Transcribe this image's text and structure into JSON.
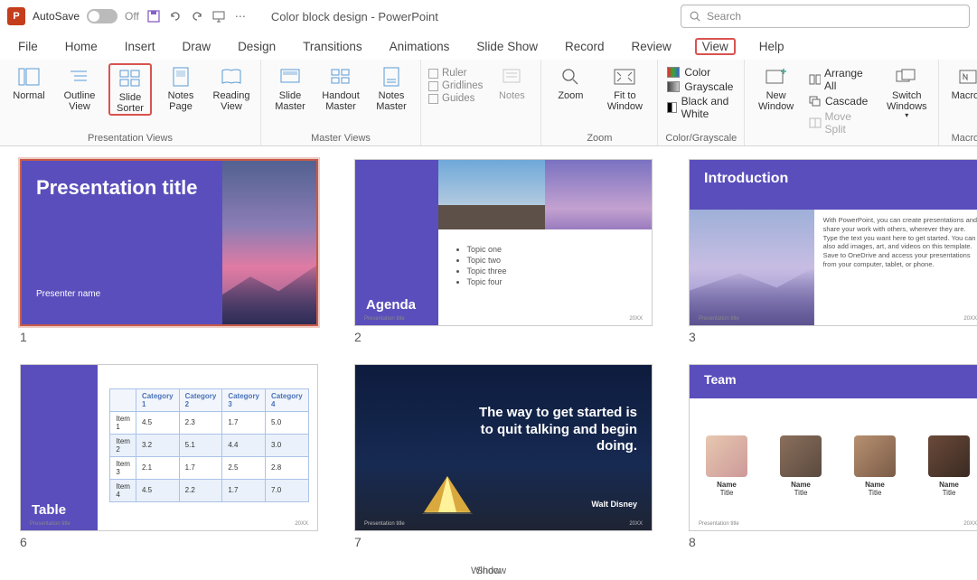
{
  "titlebar": {
    "autosave_label": "AutoSave",
    "autosave_state": "Off",
    "filename": "Color block design  -  PowerPoint",
    "search_placeholder": "Search"
  },
  "tabs": [
    "File",
    "Home",
    "Insert",
    "Draw",
    "Design",
    "Transitions",
    "Animations",
    "Slide Show",
    "Record",
    "Review",
    "View",
    "Help"
  ],
  "selected_tab": "View",
  "ribbon": {
    "presentation_views": {
      "label": "Presentation Views",
      "normal": "Normal",
      "outline": "Outline View",
      "sorter": "Slide Sorter",
      "notes": "Notes Page",
      "reading": "Reading View"
    },
    "master_views": {
      "label": "Master Views",
      "slide": "Slide Master",
      "handout": "Handout Master",
      "notes": "Notes Master"
    },
    "show": {
      "label": "Show",
      "ruler": "Ruler",
      "gridlines": "Gridlines",
      "guides": "Guides",
      "notes": "Notes"
    },
    "zoom": {
      "label": "Zoom",
      "zoom": "Zoom",
      "fit": "Fit to Window"
    },
    "colorgs": {
      "label": "Color/Grayscale",
      "color": "Color",
      "grayscale": "Grayscale",
      "bw": "Black and White"
    },
    "window": {
      "label": "Window",
      "new": "New Window",
      "arrange": "Arrange All",
      "cascade": "Cascade",
      "movesplit": "Move Split",
      "switch": "Switch Windows"
    },
    "macros": {
      "label": "Macros",
      "macros": "Macros"
    }
  },
  "slides": {
    "s1": {
      "num": "1",
      "title": "Presentation title",
      "sub": "Presenter name"
    },
    "s2": {
      "num": "2",
      "title": "Agenda",
      "topics": [
        "Topic one",
        "Topic two",
        "Topic three",
        "Topic four"
      ]
    },
    "s3": {
      "num": "3",
      "title": "Introduction",
      "body": "With PowerPoint, you can create presentations and share your work with others, wherever they are. Type the text you want here to get started. You can also add images, art, and videos on this template. Save to OneDrive and access your presentations from your computer, tablet, or phone."
    },
    "s4": {
      "num": "6",
      "title": "Table",
      "headers": [
        "",
        "Category 1",
        "Category 2",
        "Category 3",
        "Category 4"
      ],
      "rows": [
        [
          "Item 1",
          "4.5",
          "2.3",
          "1.7",
          "5.0"
        ],
        [
          "Item 2",
          "3.2",
          "5.1",
          "4.4",
          "3.0"
        ],
        [
          "Item 3",
          "2.1",
          "1.7",
          "2.5",
          "2.8"
        ],
        [
          "Item 4",
          "4.5",
          "2.2",
          "1.7",
          "7.0"
        ]
      ]
    },
    "s5": {
      "num": "7",
      "quote": "The way to get started is to quit  talking and begin doing.",
      "attr": "Walt Disney"
    },
    "s6": {
      "num": "8",
      "title": "Team",
      "name": "Name",
      "role": "Title"
    },
    "footer_placeholder": "Presentation title",
    "footer_date": "20XX"
  }
}
